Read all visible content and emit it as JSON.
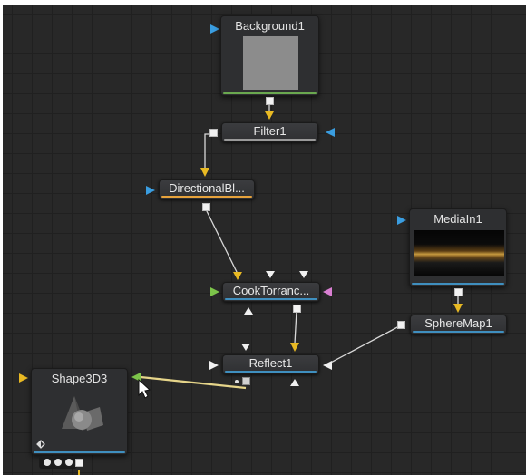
{
  "nodes": {
    "background1": {
      "label": "Background1"
    },
    "filter1": {
      "label": "Filter1"
    },
    "directional_blur": {
      "label": "DirectionalBl..."
    },
    "mediain1": {
      "label": "MediaIn1"
    },
    "cook_torrance": {
      "label": "CookTorranc..."
    },
    "spheremap1": {
      "label": "SphereMap1"
    },
    "reflect1": {
      "label": "Reflect1"
    },
    "shape3d3": {
      "label": "Shape3D3"
    }
  },
  "colors": {
    "canvas": "#282828",
    "image_bar": "#6aa84f",
    "blur_bar": "#e6a23c",
    "material_bar": "#3f8fbf",
    "input_arrow_yellow": "#e8b923",
    "input_arrow_blue": "#3a9de0",
    "input_arrow_green": "#7cc44a",
    "input_arrow_pink": "#d97fd2",
    "active_wire": "#e6d58a"
  },
  "icons": [
    "arrow-cursor-icon",
    "shape3d-icon",
    "view-toggle-icon"
  ]
}
